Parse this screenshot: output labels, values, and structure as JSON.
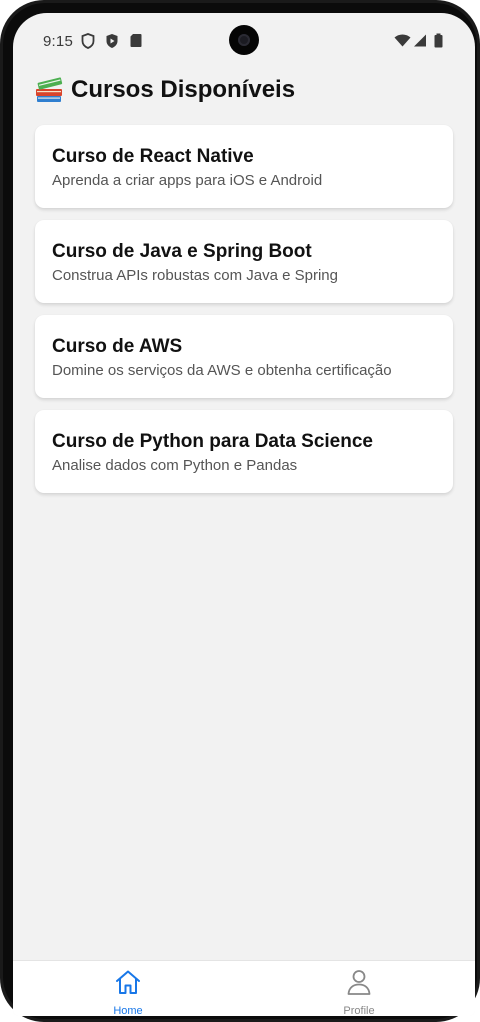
{
  "status_bar": {
    "time": "9:15",
    "left_icons": [
      "shield-icon",
      "play-protect-icon",
      "sd-card-icon"
    ],
    "right_icons": [
      "wifi-icon",
      "signal-icon",
      "battery-icon"
    ]
  },
  "header": {
    "icon": "books-icon",
    "title": "Cursos Disponíveis"
  },
  "courses": [
    {
      "title": "Curso de React Native",
      "description": "Aprenda a criar apps para iOS e Android"
    },
    {
      "title": "Curso de Java e Spring Boot",
      "description": "Construa APIs robustas com Java e Spring"
    },
    {
      "title": "Curso de AWS",
      "description": "Domine os serviços da AWS e obtenha certificação"
    },
    {
      "title": "Curso de Python para Data Science",
      "description": "Analise dados com Python e Pandas"
    }
  ],
  "tab_bar": {
    "tabs": [
      {
        "label": "Home",
        "icon": "home-icon",
        "active": true
      },
      {
        "label": "Profile",
        "icon": "profile-icon",
        "active": false
      }
    ],
    "active_color": "#1877e8",
    "inactive_color": "#888888"
  }
}
